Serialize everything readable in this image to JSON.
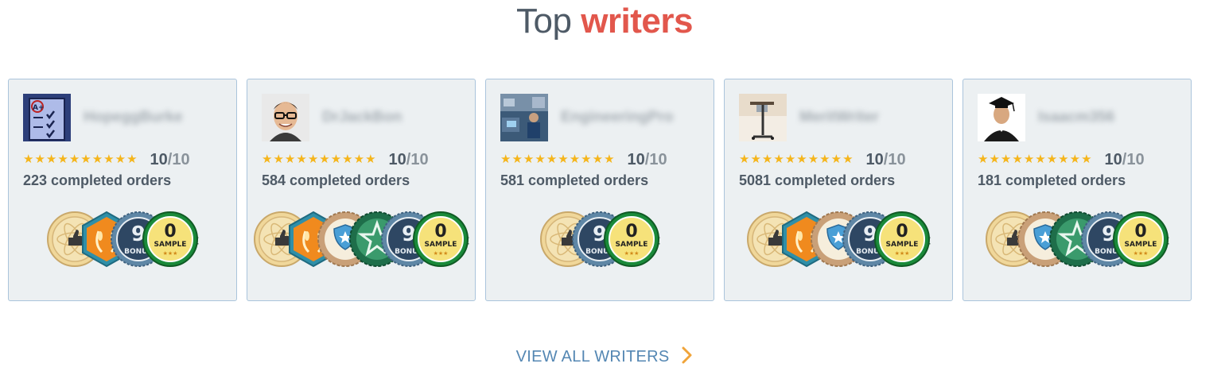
{
  "section": {
    "title_plain": "Top",
    "title_accent": "writers",
    "view_all_label": "VIEW ALL WRITERS"
  },
  "writers": [
    {
      "avatar": "clipboard-checklist-avatar",
      "name": "HopeggBurke",
      "stars": 10,
      "score": "10",
      "out_of": "/10",
      "orders": "223 completed orders",
      "badges": [
        "atom-badge",
        "laurel-badge",
        "bonus-badge",
        "sample-badge"
      ]
    },
    {
      "avatar": "man-glasses-avatar",
      "name": "DrJackBon",
      "stars": 10,
      "score": "10",
      "out_of": "/10",
      "orders": "584 completed orders",
      "badges": [
        "atom-badge",
        "laurel-badge",
        "shield-badge",
        "star-badge",
        "bonus-badge",
        "sample-badge"
      ]
    },
    {
      "avatar": "lab-worker-avatar",
      "name": "EngineeringPro",
      "stars": 10,
      "score": "10",
      "out_of": "/10",
      "orders": "581 completed orders",
      "badges": [
        "atom-badge",
        "bonus-badge",
        "sample-badge"
      ]
    },
    {
      "avatar": "desk-stand-avatar",
      "name": "MeritWriter",
      "stars": 10,
      "score": "10",
      "out_of": "/10",
      "orders": "5081 completed orders",
      "badges": [
        "atom-badge",
        "laurel-badge",
        "shield-badge",
        "bonus-badge",
        "sample-badge"
      ]
    },
    {
      "avatar": "graduate-avatar",
      "name": "Isaacm356",
      "stars": 10,
      "score": "10",
      "out_of": "/10",
      "orders": "181 completed orders",
      "badges": [
        "atom-badge",
        "shield-badge",
        "star-badge",
        "bonus-badge",
        "sample-badge"
      ]
    }
  ],
  "badge_text": {
    "bonus": "BONUS",
    "sample": "SAMPLE"
  },
  "colors": {
    "accent": "#e2574c",
    "star": "#f5b51b",
    "link": "#5487b3",
    "chevron": "#f0a43a",
    "card_bg": "#ecf0f2",
    "card_border": "#aac4dc"
  }
}
